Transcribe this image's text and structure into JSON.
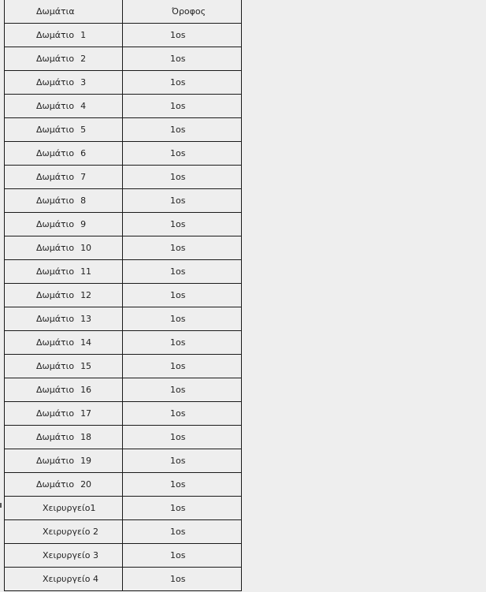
{
  "table": {
    "headers": {
      "room": "Δωμάτια",
      "floor": "Όροφος"
    },
    "rows": [
      {
        "name": "Δωμάτιο",
        "num": "1",
        "floor": "1os"
      },
      {
        "name": "Δωμάτιο",
        "num": "2",
        "floor": "1os"
      },
      {
        "name": "Δωμάτιο",
        "num": "3",
        "floor": "1os"
      },
      {
        "name": "Δωμάτιο",
        "num": "4",
        "floor": "1os"
      },
      {
        "name": "Δωμάτιο",
        "num": "5",
        "floor": "1os"
      },
      {
        "name": "Δωμάτιο",
        "num": "6",
        "floor": "1os"
      },
      {
        "name": "Δωμάτιο",
        "num": "7",
        "floor": "1os"
      },
      {
        "name": "Δωμάτιο",
        "num": "8",
        "floor": "1os"
      },
      {
        "name": "Δωμάτιο",
        "num": "9",
        "floor": "1os"
      },
      {
        "name": "Δωμάτιο",
        "num": "10",
        "floor": "1os"
      },
      {
        "name": "Δωμάτιο",
        "num": "11",
        "floor": "1os"
      },
      {
        "name": "Δωμάτιο",
        "num": "12",
        "floor": "1os"
      },
      {
        "name": "Δωμάτιο",
        "num": "13",
        "floor": "1os"
      },
      {
        "name": "Δωμάτιο",
        "num": "14",
        "floor": "1os"
      },
      {
        "name": "Δωμάτιο",
        "num": "15",
        "floor": "1os"
      },
      {
        "name": "Δωμάτιο",
        "num": "16",
        "floor": "1os"
      },
      {
        "name": "Δωμάτιο",
        "num": "17",
        "floor": "1os"
      },
      {
        "name": "Δωμάτιο",
        "num": "18",
        "floor": "1os"
      },
      {
        "name": "Δωμάτιο",
        "num": "19",
        "floor": "1os"
      },
      {
        "name": "Δωμάτιο",
        "num": "20",
        "floor": "1os"
      },
      {
        "name": "Χειρυργείο1",
        "num": "",
        "floor": "1os"
      },
      {
        "name": "Χειρυργείο 2",
        "num": "",
        "floor": "1os"
      },
      {
        "name": "Χειρυργείο 3",
        "num": "",
        "floor": "1os"
      },
      {
        "name": "Χειρυργείο 4",
        "num": "",
        "floor": "1os"
      }
    ]
  }
}
